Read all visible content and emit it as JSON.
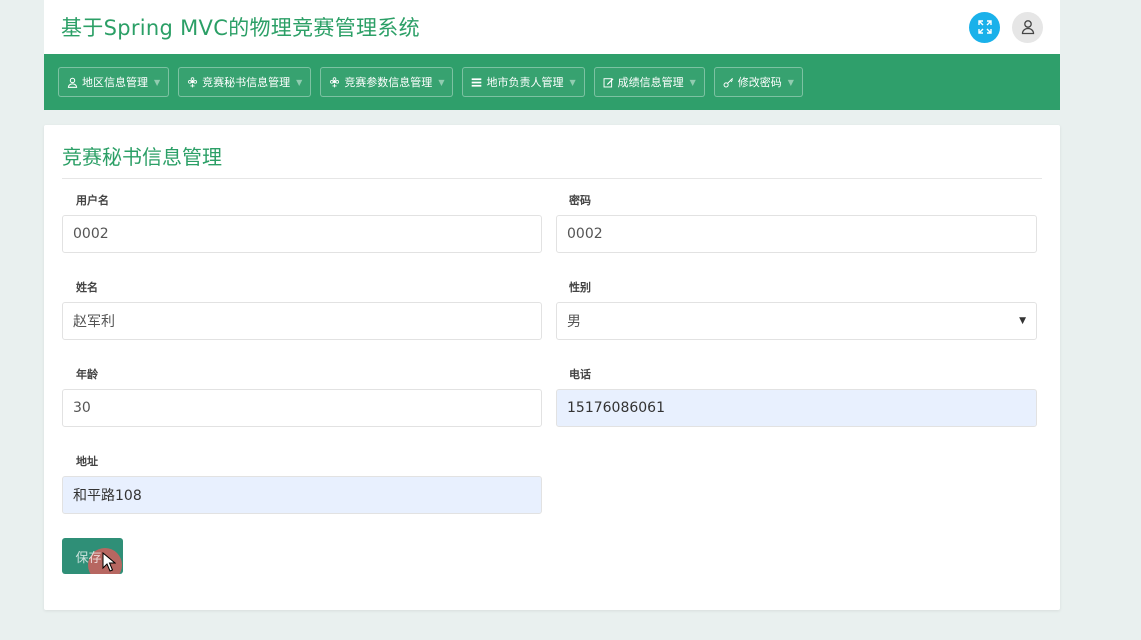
{
  "header": {
    "title": "基于Spring MVC的物理竞赛管理系统",
    "fullscreen_icon": "expand-icon",
    "user_icon": "user-icon"
  },
  "nav": {
    "items": [
      {
        "label": "地区信息管理",
        "icon": "user-icon"
      },
      {
        "label": "竞赛秘书信息管理",
        "icon": "flower-icon"
      },
      {
        "label": "竞赛参数信息管理",
        "icon": "flower-icon"
      },
      {
        "label": "地市负责人管理",
        "icon": "list-icon"
      },
      {
        "label": "成绩信息管理",
        "icon": "edit-icon"
      },
      {
        "label": "修改密码",
        "icon": "key-icon"
      }
    ]
  },
  "form": {
    "title": "竞赛秘书信息管理",
    "username_label": "用户名",
    "username_value": "0002",
    "password_label": "密码",
    "password_value": "0002",
    "name_label": "姓名",
    "name_value": "赵军利",
    "gender_label": "性别",
    "gender_value": "男",
    "age_label": "年龄",
    "age_value": "30",
    "phone_label": "电话",
    "phone_value": "15176086061",
    "address_label": "地址",
    "address_value": "和平路108",
    "save_label": "保存"
  },
  "colors": {
    "brand": "#2b9f66",
    "navbar": "#2f9f6b",
    "fullscreen_button": "#1ab1ea",
    "autofill": "#e8f0fe"
  }
}
